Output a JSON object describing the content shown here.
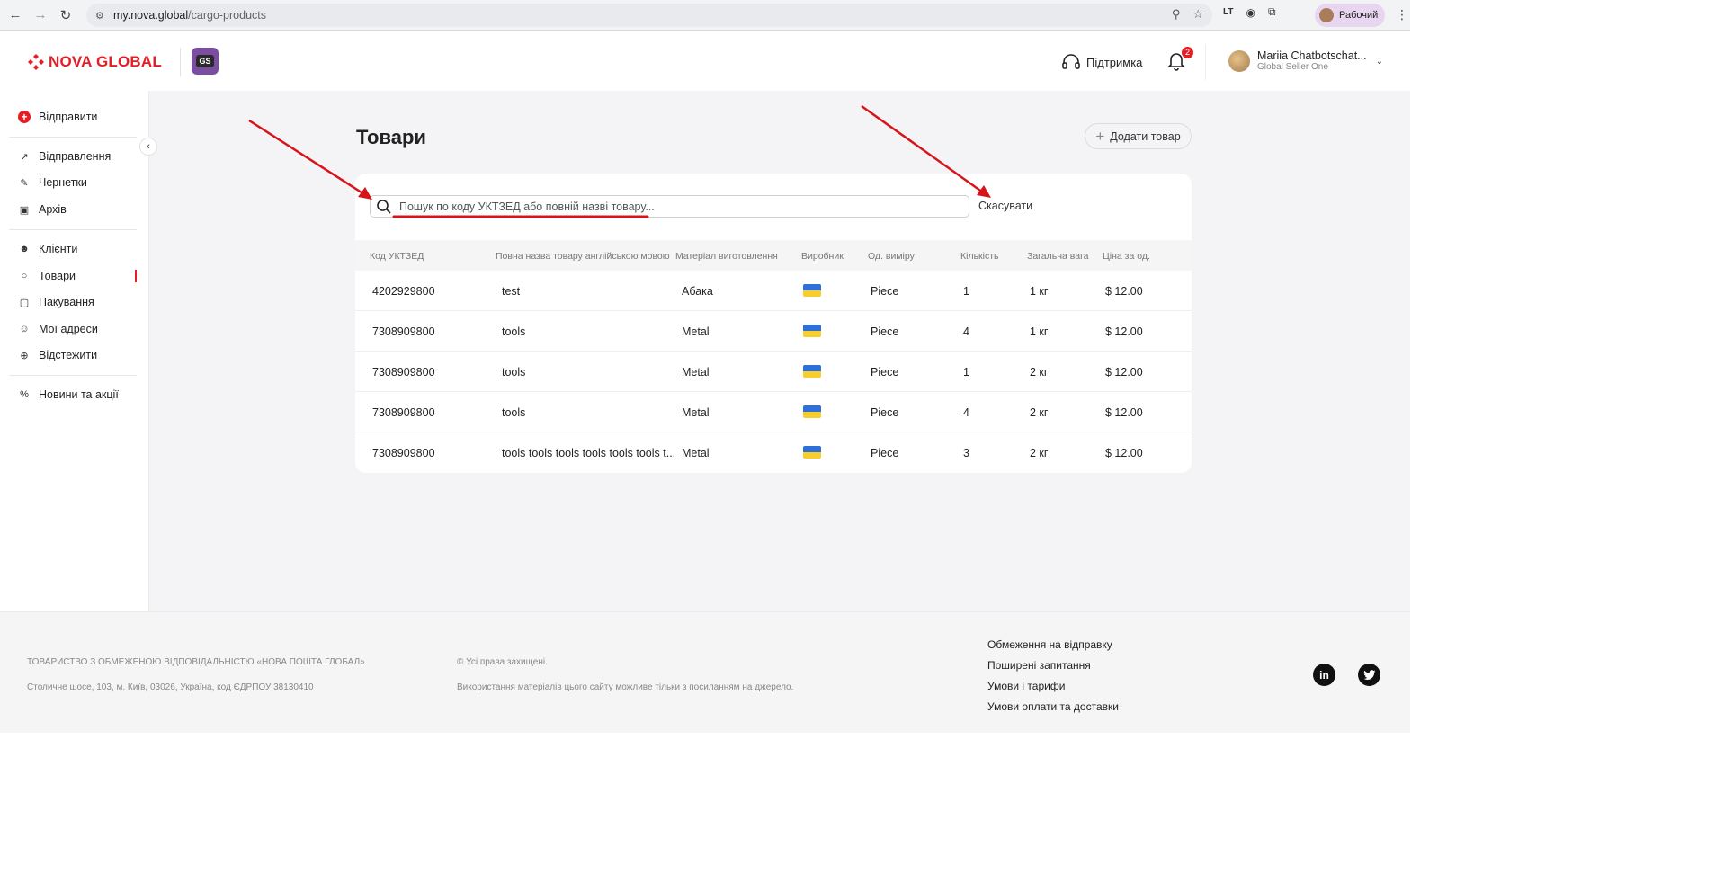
{
  "browser": {
    "url_host": "my.nova.global",
    "url_path": "/cargo-products",
    "profile_label": "Рабочий",
    "ext_label": "LT"
  },
  "header": {
    "logo_text": "NOVA GLOBAL",
    "badge_text": "GS",
    "support_label": "Підтримка",
    "notifications_count": "2",
    "user_name": "Mariia Chatbotschat...",
    "user_role": "Global Seller One"
  },
  "sidebar": {
    "send_label": "Відправити",
    "items": [
      {
        "label": "Відправлення"
      },
      {
        "label": "Чернетки"
      },
      {
        "label": "Архів"
      },
      {
        "label": "Клієнти"
      },
      {
        "label": "Товари"
      },
      {
        "label": "Пакування"
      },
      {
        "label": "Мої адреси"
      },
      {
        "label": "Відстежити"
      },
      {
        "label": "Новини та акції"
      }
    ]
  },
  "main": {
    "title": "Товари",
    "add_button": "Додати товар",
    "search_placeholder": "Пошук по коду УКТЗЕД або повній назві товару...",
    "cancel_label": "Скасувати",
    "columns": [
      "Код УКТЗЕД",
      "Повна назва товару англійською мовою",
      "Матеріал виготовлення",
      "Виробник",
      "Од. виміру",
      "Кількість",
      "Загальна вага",
      "Ціна за од."
    ],
    "rows": [
      {
        "code": "4202929800",
        "name": "test",
        "material": "Абака",
        "unit": "Piece",
        "qty": "1",
        "weight": "1 кг",
        "price": "$ 12.00"
      },
      {
        "code": "7308909800",
        "name": "tools",
        "material": "Metal",
        "unit": "Piece",
        "qty": "4",
        "weight": "1 кг",
        "price": "$ 12.00"
      },
      {
        "code": "7308909800",
        "name": "tools",
        "material": "Metal",
        "unit": "Piece",
        "qty": "1",
        "weight": "2 кг",
        "price": "$ 12.00"
      },
      {
        "code": "7308909800",
        "name": "tools",
        "material": "Metal",
        "unit": "Piece",
        "qty": "4",
        "weight": "2 кг",
        "price": "$ 12.00"
      },
      {
        "code": "7308909800",
        "name": "tools tools tools tools tools tools t...",
        "material": "Metal",
        "unit": "Piece",
        "qty": "3",
        "weight": "2 кг",
        "price": "$ 12.00"
      }
    ]
  },
  "footer": {
    "company": "ТОВАРИСТВО З ОБМЕЖЕНОЮ ВІДПОВІДАЛЬНІСТЮ «НОВА ПОШТА ГЛОБАЛ»",
    "address": "Столичне шосе, 103, м. Київ, 03026, Україна, код ЄДРПОУ 38130410",
    "rights": "© Усі права захищені.",
    "usage": "Використання матеріалів цього сайту можливе тільки з посиланням на джерело.",
    "links": [
      "Обмеження на відправку",
      "Поширені запитання",
      "Умови і тарифи",
      "Умови оплати та доставки"
    ],
    "social": [
      "in",
      "twitter"
    ]
  },
  "colors": {
    "brand_red": "#e31e24",
    "gs_purple": "#7b4ea1",
    "annotation_red": "#d7141a"
  }
}
